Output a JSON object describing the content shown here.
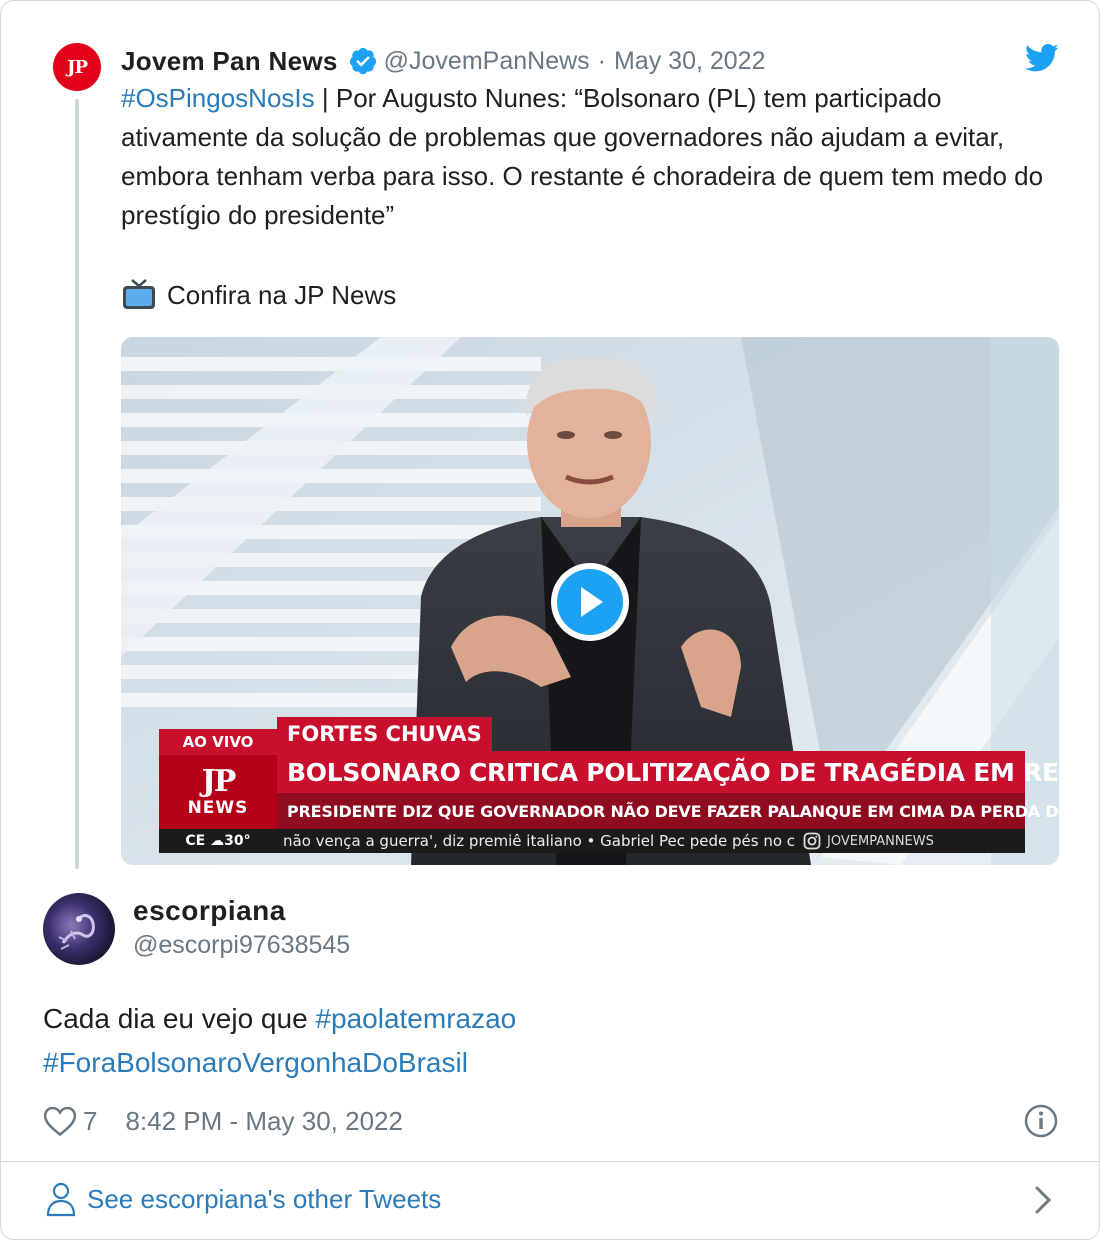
{
  "parent_tweet": {
    "author_name": "Jovem Pan News",
    "avatar_text": "JP",
    "handle": "@JovemPanNews",
    "separator": "·",
    "date": "May 30, 2022",
    "hashtag": "#OsPingosNosIs",
    "text": " | Por Augusto Nunes: “Bolsonaro (PL) tem participado ativamente da solução de problemas que governadores não ajudam a evitar, embora tenham verba para isso. O restante é choradeira de quem tem medo do prestígio do presidente”",
    "tv_line": "Confira na JP News",
    "video": {
      "live_label": "AO VIVO",
      "logo_text": "JP",
      "logo_sub": "NEWS",
      "weather": "CE ☁30°",
      "tag": "FORTES CHUVAS",
      "headline": "BOLSONARO CRITICA POLITIZAÇÃO DE TRAGÉDIA EM RECIFE",
      "subheadline": "PRESIDENTE DIZ QUE GOVERNADOR NÃO DEVE FAZER PALANQUE EM CIMA DA PERDA DO POVO",
      "ticker": "não vença a guerra', diz premiê italiano • Gabriel Pec pede pés no c",
      "ticker_handle": "JOVEMPANNEWS"
    }
  },
  "reply_tweet": {
    "author_name": "escorpiana",
    "handle": "@escorpi97638545",
    "text_prefix": "Cada dia eu vejo que ",
    "hashtag1": "#paolatemrazao",
    "hashtag2": "#ForaBolsonaroVergonhaDoBrasil",
    "like_count": "7",
    "timestamp": "8:42 PM - May 30, 2022"
  },
  "footer": {
    "link_text": "See escorpiana's other Tweets"
  },
  "colors": {
    "link": "#2b7bb9",
    "muted": "#697882",
    "twitter_blue": "#1da1f2",
    "jp_red": "#e3001b"
  }
}
